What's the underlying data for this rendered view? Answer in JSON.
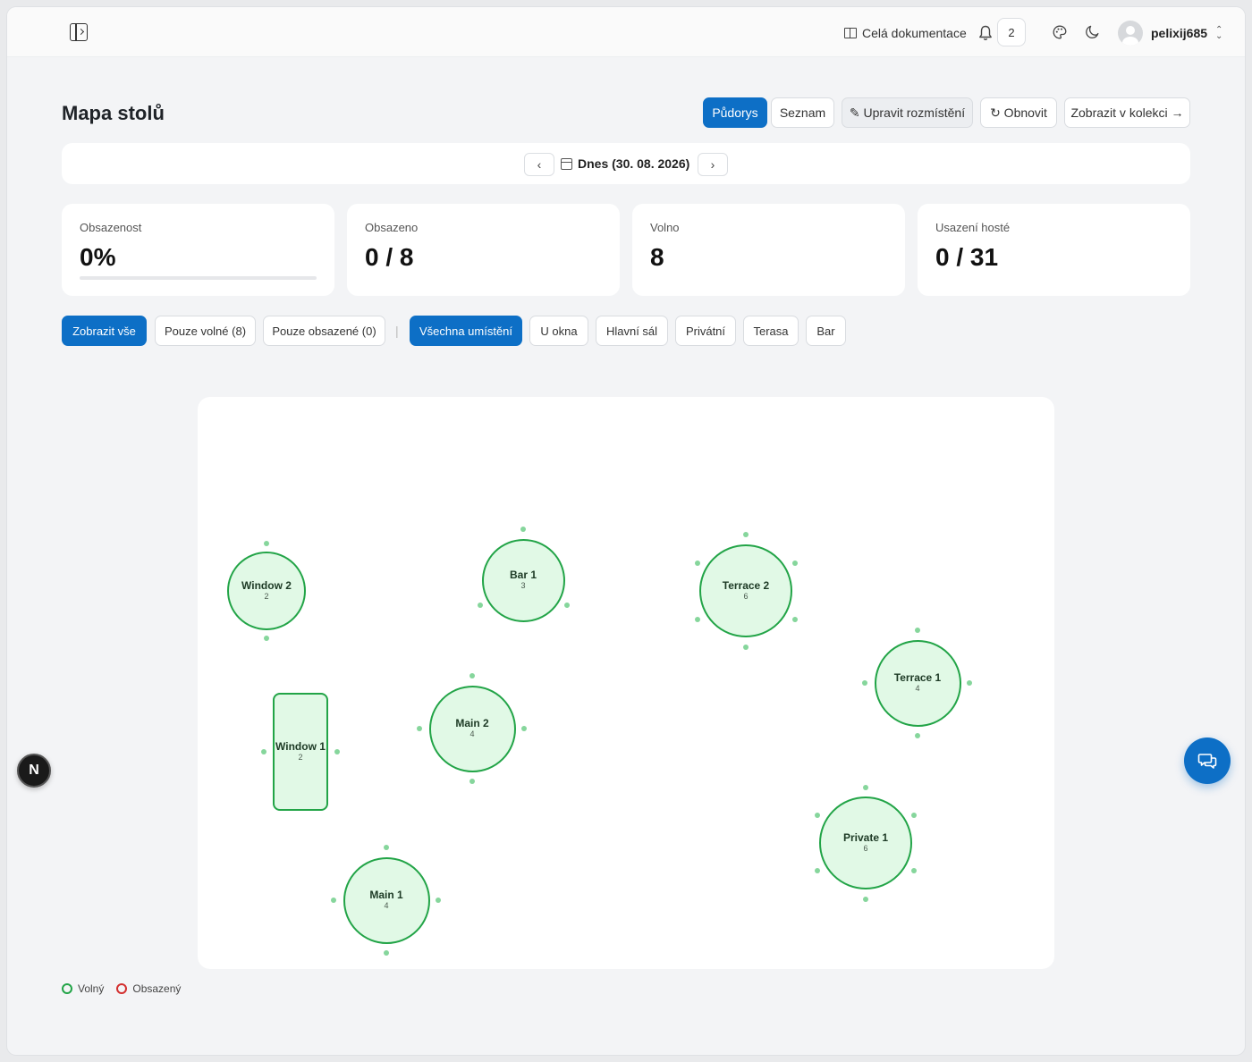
{
  "header": {
    "docs_label": "Celá dokumentace",
    "notification_count": "2",
    "username": "pelixij685"
  },
  "page": {
    "title": "Mapa stolů",
    "buttons": {
      "floorplan": "Půdorys",
      "list": "Seznam",
      "edit_layout": "✎ Upravit rozmístění",
      "refresh": "↻ Obnovit",
      "view_collection": "Zobrazit v kolekci →"
    },
    "date": {
      "label": "Dnes (30. 08. 2026)",
      "prev": "‹",
      "next": "›"
    }
  },
  "stats": [
    {
      "label": "Obsazenost",
      "value": "0%",
      "progress": 0
    },
    {
      "label": "Obsazeno",
      "value": "0 / 8"
    },
    {
      "label": "Volno",
      "value": "8"
    },
    {
      "label": "Usazení hosté",
      "value": "0 / 31"
    }
  ],
  "filters": {
    "status": [
      "Zobrazit vše",
      "Pouze volné (8)",
      "Pouze obsazené (0)"
    ],
    "separator": "|",
    "locations": [
      "Všechna umístění",
      "U okna",
      "Hlavní sál",
      "Privátní",
      "Terasa",
      "Bar"
    ]
  },
  "tables": [
    {
      "name": "Window 2",
      "capacity": "2",
      "shape": "round",
      "status": "free"
    },
    {
      "name": "Bar 1",
      "capacity": "3",
      "shape": "round",
      "status": "free"
    },
    {
      "name": "Terrace 2",
      "capacity": "6",
      "shape": "round",
      "status": "free"
    },
    {
      "name": "Terrace 1",
      "capacity": "4",
      "shape": "round",
      "status": "free"
    },
    {
      "name": "Window 1",
      "capacity": "2",
      "shape": "rect",
      "status": "free"
    },
    {
      "name": "Main 2",
      "capacity": "4",
      "shape": "round",
      "status": "free"
    },
    {
      "name": "Private 1",
      "capacity": "6",
      "shape": "round",
      "status": "free"
    },
    {
      "name": "Main 1",
      "capacity": "4",
      "shape": "round",
      "status": "free"
    }
  ],
  "legend": {
    "free": "Volný",
    "occupied": "Obsazený"
  },
  "colors": {
    "primary": "#0d6fc6",
    "free_border": "#22a447",
    "free_fill": "#e1f9e6",
    "occupied_border": "#d32f2f",
    "seat": "#86d69c"
  },
  "icons": {
    "sidebar_toggle": "sidebar-toggle-icon",
    "docs": "book-icon",
    "notifications": "bell-icon",
    "theme": "palette-icon",
    "dark_mode": "moon-icon",
    "date": "calendar-icon",
    "dev_badge": "next-logo-icon",
    "chat": "chat-icon"
  },
  "dev_badge_letter": "N"
}
